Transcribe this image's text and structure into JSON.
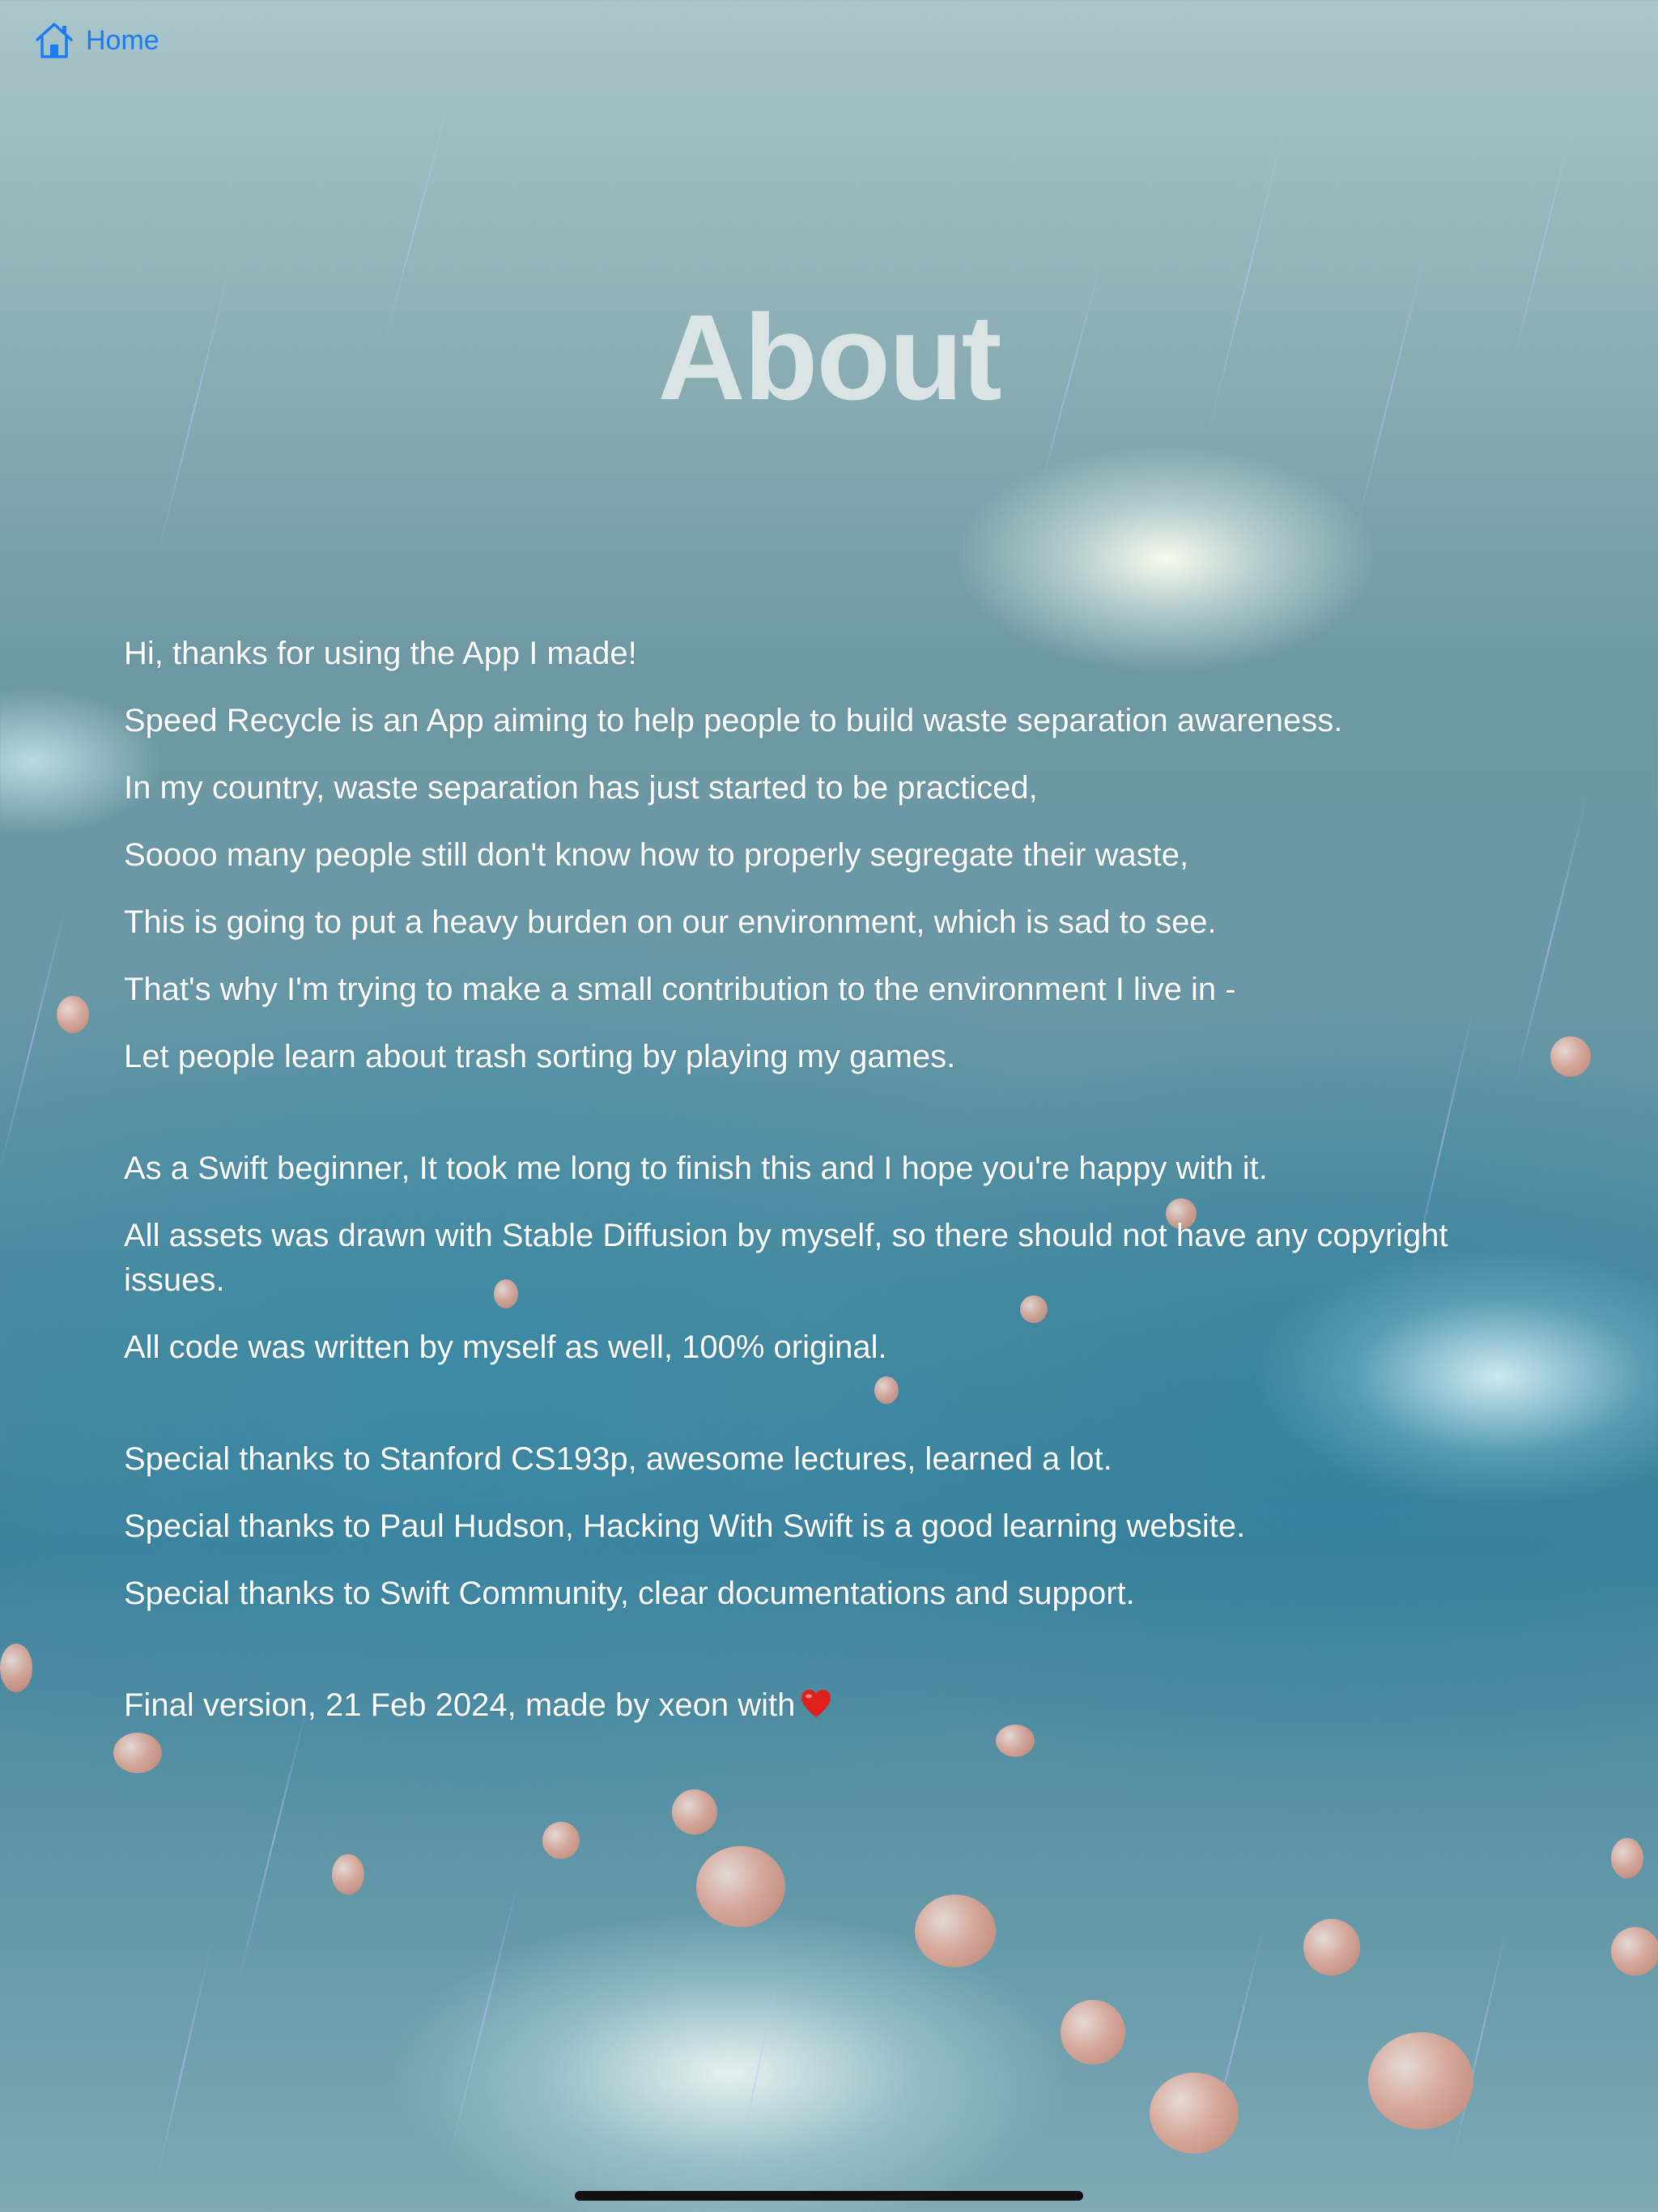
{
  "nav": {
    "home_label": "Home",
    "icon": "house-icon"
  },
  "page": {
    "title": "About"
  },
  "intro": [
    "Hi, thanks for using the App I made!",
    "Speed Recycle is an App aiming to help people to build waste separation awareness.",
    "In my country, waste separation has just started to be practiced,",
    "Soooo many people still don't know how to properly segregate their waste,",
    "This is going to put a heavy burden on our environment, which is sad to see.",
    "That's why I'm trying to make a small contribution to the environment I live in -",
    "Let people learn about trash sorting by playing my games."
  ],
  "development": [
    "As a Swift beginner, It took me long to finish this and I hope you're happy with it.",
    "All assets was drawn with Stable Diffusion by myself, so there should not have any copyright issues.",
    "All code was written by myself as well, 100% original."
  ],
  "thanks": [
    "Special thanks to Stanford CS193p, awesome lectures, learned a lot.",
    "Special thanks to Paul Hudson, Hacking With Swift is a good learning website.",
    "Special thanks to Swift Community, clear documentations and support."
  ],
  "footer": {
    "text": "Final version, 21 Feb 2024, made by xeon with",
    "icon": "heart-icon"
  },
  "colors": {
    "link": "#1a7cf0",
    "title": "#e1e8e8",
    "body_text": "#ffffff",
    "heart": "#e0201b"
  }
}
